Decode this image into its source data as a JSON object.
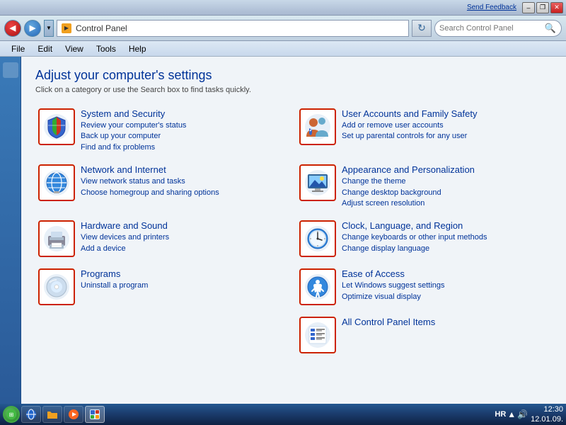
{
  "titlebar": {
    "send_feedback": "Send Feedback",
    "minimize_label": "–",
    "restore_label": "❐",
    "close_label": "✕"
  },
  "addressbar": {
    "back_icon": "◀",
    "forward_icon": "▶",
    "dropdown_icon": "▼",
    "breadcrumb_label": "Control Panel",
    "go_icon": "↻",
    "search_placeholder": "Search Control Panel",
    "search_icon": "🔍"
  },
  "menubar": {
    "items": [
      "File",
      "Edit",
      "View",
      "Tools",
      "Help"
    ]
  },
  "content": {
    "title": "Adjust your computer's settings",
    "subtitle": "Click on a category or use the Search box to find tasks quickly.",
    "categories": [
      {
        "id": "system-security",
        "title": "System and Security",
        "links": [
          "Review your computer's status",
          "Back up your computer",
          "Find and fix problems"
        ]
      },
      {
        "id": "user-accounts",
        "title": "User Accounts and Family Safety",
        "links": [
          "Add or remove user accounts",
          "Set up parental controls for any user"
        ]
      },
      {
        "id": "network-internet",
        "title": "Network and Internet",
        "links": [
          "View network status and tasks",
          "Choose homegroup and sharing options"
        ]
      },
      {
        "id": "appearance",
        "title": "Appearance and Personalization",
        "links": [
          "Change the theme",
          "Change desktop background",
          "Adjust screen resolution"
        ]
      },
      {
        "id": "hardware-sound",
        "title": "Hardware and Sound",
        "links": [
          "View devices and printers",
          "Add a device"
        ]
      },
      {
        "id": "clock-language",
        "title": "Clock, Language, and Region",
        "links": [
          "Change keyboards or other input methods",
          "Change display language"
        ]
      },
      {
        "id": "programs",
        "title": "Programs",
        "links": [
          "Uninstall a program"
        ]
      },
      {
        "id": "ease-of-access",
        "title": "Ease of Access",
        "links": [
          "Let Windows suggest settings",
          "Optimize visual display"
        ]
      },
      {
        "id": "all-items",
        "title": "All Control Panel Items",
        "links": []
      }
    ]
  },
  "taskbar": {
    "time": "12:30",
    "date": "12.01.09.",
    "lang": "HR"
  }
}
